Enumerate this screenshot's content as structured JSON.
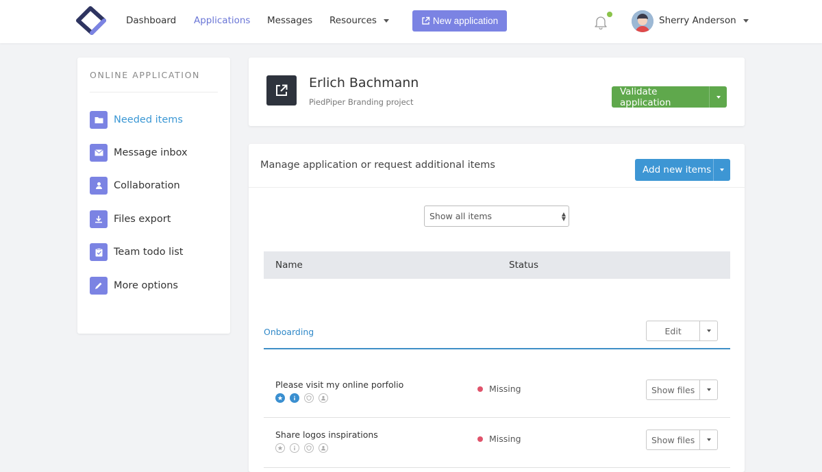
{
  "nav": {
    "links": [
      {
        "label": "Dashboard"
      },
      {
        "label": "Applications"
      },
      {
        "label": "Messages"
      },
      {
        "label": "Resources"
      }
    ],
    "new_app_label": "New application",
    "user_name": "Sherry Anderson",
    "accent": "#7b83e3",
    "notification_dot_color": "#8ac34a"
  },
  "sidebar": {
    "title": "ONLINE APPLICATION",
    "items": [
      {
        "label": "Needed items",
        "icon": "folder-icon"
      },
      {
        "label": "Message inbox",
        "icon": "envelope-icon"
      },
      {
        "label": "Collaboration",
        "icon": "users-icon"
      },
      {
        "label": "Files export",
        "icon": "download-icon"
      },
      {
        "label": "Team todo list",
        "icon": "clipboard-icon"
      },
      {
        "label": "More options",
        "icon": "pencil-icon"
      }
    ]
  },
  "header": {
    "name": "Erlich Bachmann",
    "subtitle": "PiedPiper Branding project",
    "validate_label": "Validate application"
  },
  "main": {
    "title": "Manage application or request additional items",
    "add_label": "Add new items",
    "filter_value": "Show all items",
    "columns": [
      "Name",
      "Status"
    ],
    "section": {
      "label": "Onboarding",
      "edit_label": "Edit"
    },
    "items": [
      {
        "title": "Please visit my online porfolio",
        "status": "Missing",
        "status_color": "#e0536b",
        "files_label": "Show files",
        "icons": [
          "star-icon",
          "info-icon",
          "shield-icon",
          "user-icon"
        ],
        "active_icons": [
          true,
          true,
          false,
          false
        ]
      },
      {
        "title": "Share logos inspirations",
        "status": "Missing",
        "status_color": "#e0536b",
        "files_label": "Show files",
        "icons": [
          "star-icon",
          "info-icon",
          "shield-icon",
          "user-icon"
        ],
        "active_icons": [
          false,
          false,
          false,
          false
        ]
      }
    ]
  }
}
